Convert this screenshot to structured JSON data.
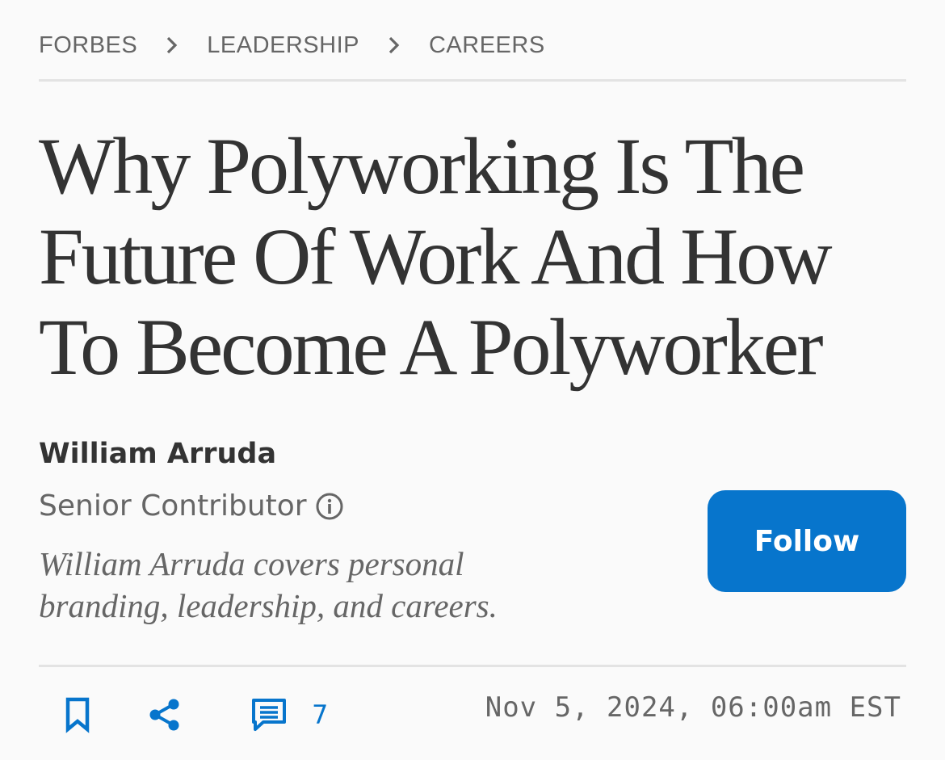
{
  "breadcrumb": {
    "items": [
      "FORBES",
      "LEADERSHIP",
      "CAREERS"
    ],
    "separator_icon": "chevron-right-icon"
  },
  "article": {
    "title_lines": [
      "Why Polyworking Is The",
      "Future Of Work And How",
      "To Become A Polyworker"
    ]
  },
  "author": {
    "name": "William Arruda",
    "role": "Senior Contributor",
    "role_icon": "info-icon",
    "bio_lines": [
      "William Arruda covers personal",
      "branding, leadership, and careers."
    ],
    "follow_label": "Follow"
  },
  "actions": {
    "bookmark_icon": "bookmark-icon",
    "share_icon": "share-icon",
    "comment_icon": "comment-icon",
    "comment_count": "7"
  },
  "published": "Nov 5, 2024, 06:00am EST",
  "colors": {
    "accent": "#0775cc",
    "text": "#333333",
    "muted": "#666666",
    "background": "#fafafa",
    "divider": "#e3e3e3"
  }
}
